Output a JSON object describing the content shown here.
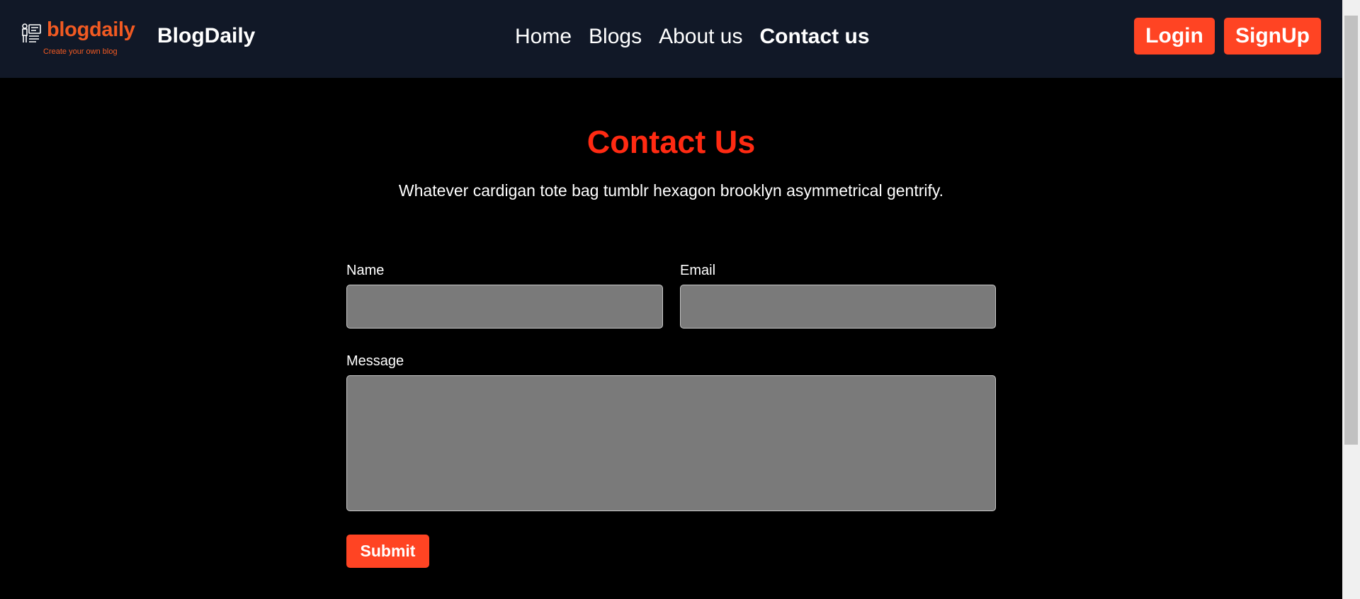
{
  "navbar": {
    "logo": {
      "wordmark": "blogdaily",
      "tagline": "Create your own blog",
      "icon": "blog-tools-icon"
    },
    "brand": "BlogDaily",
    "links": [
      {
        "label": "Home",
        "active": false
      },
      {
        "label": "Blogs",
        "active": false
      },
      {
        "label": "About us",
        "active": false
      },
      {
        "label": "Contact us",
        "active": true
      }
    ],
    "login_label": "Login",
    "signup_label": "SignUp"
  },
  "contact": {
    "title": "Contact Us",
    "subtitle": "Whatever cardigan tote bag tumblr hexagon brooklyn asymmetrical gentrify.",
    "name_label": "Name",
    "name_value": "",
    "email_label": "Email",
    "email_value": "",
    "message_label": "Message",
    "message_value": "",
    "submit_label": "Submit"
  },
  "colors": {
    "navbar_bg": "#111827",
    "page_bg": "#000000",
    "accent": "#ff4423",
    "title": "#ff2a12",
    "logo": "#f25a22",
    "input_bg": "#7a7a7a"
  }
}
